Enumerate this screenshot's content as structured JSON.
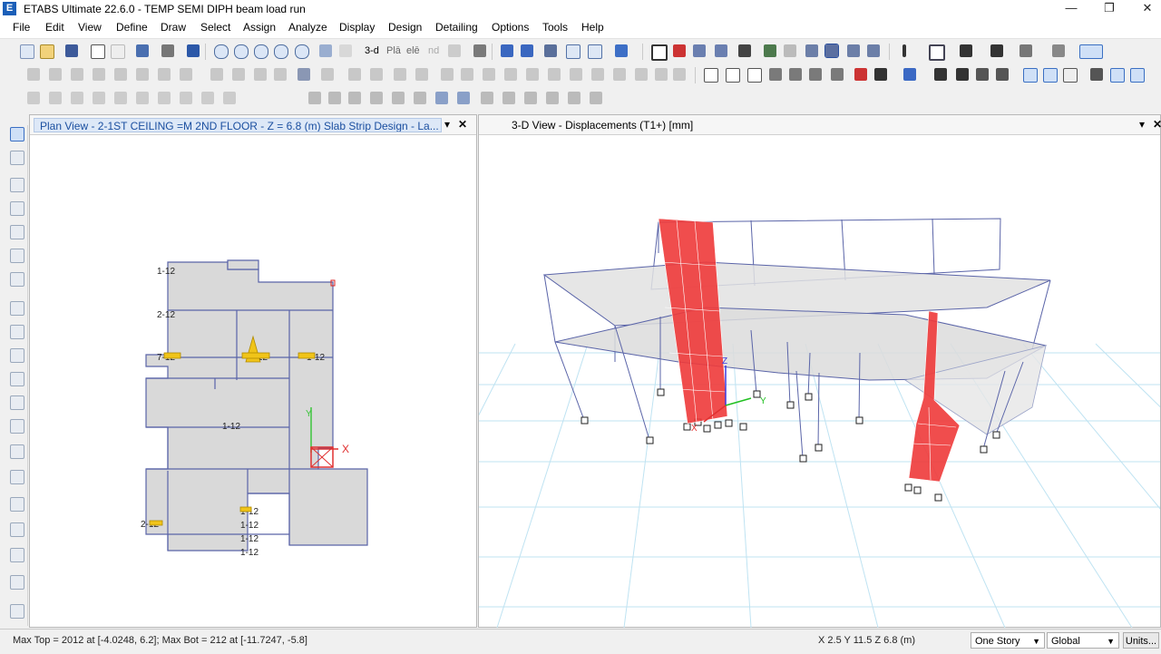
{
  "window": {
    "app_icon_letter": "E",
    "title": "ETABS Ultimate 22.6.0 - TEMP SEMI DIPH beam load run",
    "controls": [
      "—",
      "❐",
      "✕"
    ]
  },
  "menu": [
    "File",
    "Edit",
    "View",
    "Define",
    "Draw",
    "Select",
    "Assign",
    "Analyze",
    "Display",
    "Design",
    "Detailing",
    "Options",
    "Tools",
    "Help"
  ],
  "toolbar": {
    "view_3d": "3-d",
    "plan": "Plā",
    "elev": "elē",
    "nd": "nd"
  },
  "plan_view": {
    "tab_title": "Plan View - 2-1ST CEILING =M 2ND FLOOR - Z = 6.8 (m)  Slab Strip Design - La...",
    "dropdown": "▾",
    "close": "✕",
    "grid_labels": [
      "1-12",
      "2-12",
      "7-12",
      "1-12",
      "1-12",
      "1-12",
      "2-12",
      "1-12",
      "1-12",
      "1-12",
      "1-12"
    ],
    "axis_x": "X",
    "axis_y": "Y"
  },
  "view_3d": {
    "tab_title": "3-D View  - Displacements (T1+)  [mm]",
    "dropdown": "▾",
    "close": "✕",
    "axis_x": "X",
    "axis_y": "Y",
    "axis_z": "Z"
  },
  "status": {
    "left": "Max Top = 2012 at [-4.0248, 6.2];  Max Bot = 212 at [-11.7247, -5.8]",
    "coords": "X 2.5  Y 11.5  Z 6.8 (m)",
    "story_select": "One Story",
    "coord_select": "Global",
    "units_button": "Units..."
  },
  "colors": {
    "frame": "#5a64a8",
    "slab": "#d6d6d6",
    "wall": "#ee3a3a",
    "grid": "#bfe3f2",
    "accent": "#1b4fa0"
  }
}
